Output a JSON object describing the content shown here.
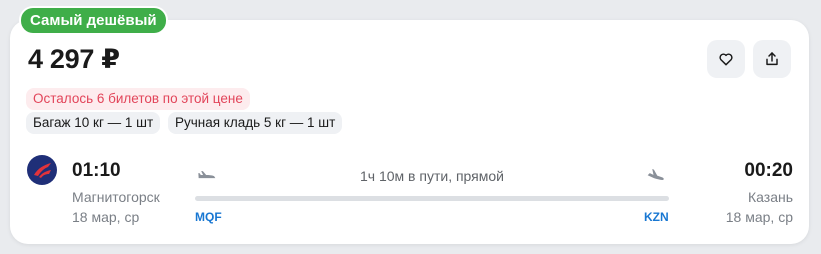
{
  "badge": {
    "label": "Самый дешёвый",
    "color": "#3fae49"
  },
  "price": "4 297 ₽",
  "actions": {
    "favorite_icon": "heart-icon",
    "share_icon": "share-icon"
  },
  "tickets_left": "Осталось 6 билетов по этой цене",
  "chips": {
    "baggage": "Багаж 10 кг — 1 шт",
    "hand_luggage": "Ручная кладь 5 кг — 1 шт"
  },
  "flight": {
    "airline_logo_icon": "airline-logo-icon",
    "departure": {
      "time": "01:10",
      "city": "Магнитогорск",
      "date": "18 мар, ср",
      "iata": "MQF"
    },
    "arrival": {
      "time": "00:20",
      "city": "Казань",
      "date": "18 мар, ср",
      "iata": "KZN"
    },
    "duration": "1ч 10м в пути, прямой",
    "takeoff_icon": "plane-takeoff-icon",
    "landing_icon": "plane-landing-icon"
  },
  "colors": {
    "accent": "#1877d2",
    "warning_text": "#e2455a",
    "warning_bg": "#fdecee"
  }
}
